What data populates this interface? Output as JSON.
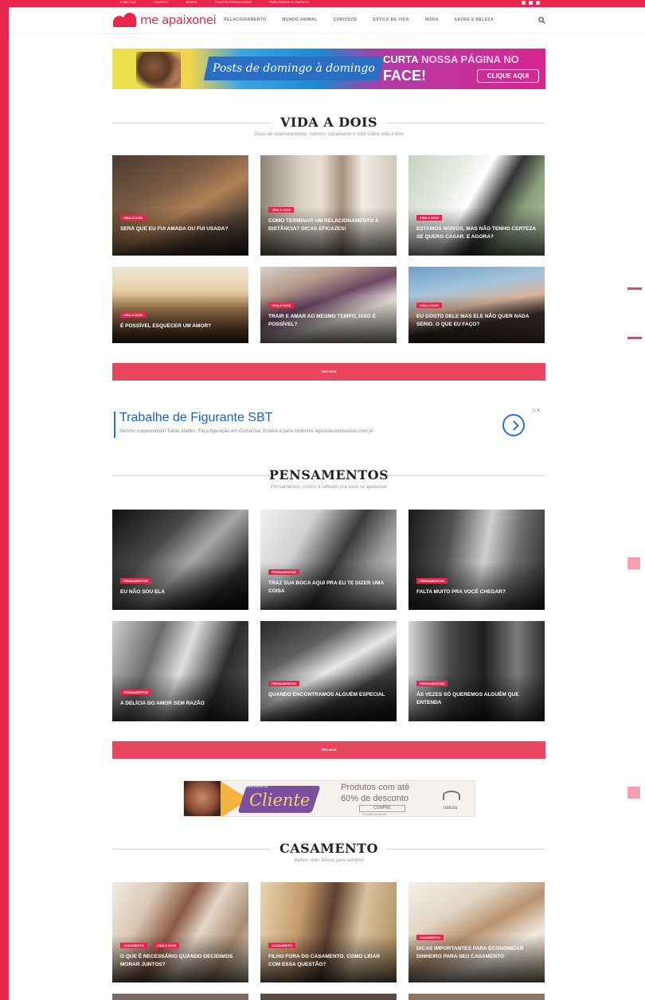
{
  "topbar": {
    "links": [
      "COMO FAZ",
      "CONTATO",
      "BRASIL",
      "POLÍTICA PRIVACIDADE",
      "PUBLICIDADE E CONTATO"
    ]
  },
  "header": {
    "logo_text": "me apaixonei",
    "nav": [
      "RELACIONAMENTO",
      "MUNDO ANIMAL",
      "CURIOSOS",
      "ESTILO DE VIDA",
      "MODA",
      "SAÚDE E BELEZA"
    ],
    "accent": "#e8254a"
  },
  "banner": {
    "script_text": "Posts de domingo à domingo",
    "cta_curta": "CURTA",
    "cta_nossa": "NOSSA PÁGINA NO",
    "cta_face": "FACE!",
    "button": "CLIQUE AQUI"
  },
  "sections": [
    {
      "title": "VIDA A DOIS",
      "subtitle": "Dicas de relacionamento, namoro, casamento e tudo sobre vida a dois",
      "see_more": "VER MAIS",
      "cards": [
        {
          "tag": "VIDA A DOIS",
          "title": "SERÁ QUE EU FUI AMADA OU FUI USADA?"
        },
        {
          "tag": "VIDA A DOIS",
          "title": "COMO TERMINAR UM RELACIONAMENTO À DISTÂNCIA? DICAS EFICAZES!"
        },
        {
          "tag": "VIDA A DOIS",
          "title": "ESTAMOS NOIVOS, MAS NÃO TENHO CERTEZA SE QUERO CASAR. E AGORA?"
        },
        {
          "tag": "VIDA A DOIS",
          "title": "É POSSÍVEL ESQUECER UM AMOR?"
        },
        {
          "tag": "VIDA A DOIS",
          "title": "TRAIR E AMAR AO MESMO TEMPO, ISSO É POSSÍVEL?"
        },
        {
          "tag": "VIDA A DOIS",
          "title": "EU GOSTO DELE MAS ELE NÃO QUER NADA SÉRIO. O QUE EU FAÇO?"
        }
      ]
    },
    {
      "title": "PENSAMENTOS",
      "subtitle": "Pensamentos, contos e reflexos pra você se apaixonar",
      "see_more": "VER MAIS",
      "cards": [
        {
          "tag": "PENSAMENTOS",
          "title": "EU NÃO SOU ELA"
        },
        {
          "tag": "PENSAMENTOS",
          "title": "TRAZ SUA BOCA AQUI PRA EU TE DIZER UMA COISA"
        },
        {
          "tag": "PENSAMENTOS",
          "title": "FALTA MUITO PRA VOCÊ CHEGAR?"
        },
        {
          "tag": "PENSAMENTOS",
          "title": "A DELÍCIA DO AMOR SEM RAZÃO"
        },
        {
          "tag": "PENSAMENTOS",
          "title": "QUANDO ENCONTRAMOS ALGUÉM ESPECIAL"
        },
        {
          "tag": "PENSAMENTOS",
          "title": "ÀS VEZES SÓ QUEREMOS ALGUÉM QUE ENTENDA"
        }
      ]
    },
    {
      "title": "CASAMENTO",
      "subtitle": "Vamos viver felizes para sempre!",
      "cards": [
        {
          "tag": "CASAMENTO",
          "tag2": "VIDA A DOIS",
          "title": "O QUE É NECESSÁRIO QUANDO DECIDIMOS MORAR JUNTOS?"
        },
        {
          "tag": "CASAMENTO",
          "title": "FILHO FORA DO CASAMENTO. COMO LIDAR COM ESSA QUESTÃO?"
        },
        {
          "tag": "CASAMENTO",
          "title": "DICAS IMPORTANTES PARA ECONOMIZAR DINHEIRO PARA SEU CASAMENTO"
        }
      ]
    }
  ],
  "ad_text": {
    "title": "Trabalhe de Figurante SBT",
    "desc": "Mesmo surpreendido! Todas Idades, Faça figuração em Comercial, Novela e para melhores agencias/emissoras com jo",
    "choice": "▷✕"
  },
  "ad_natura": {
    "pill_small": "Semana do",
    "pill_big": "Cliente",
    "line1": "Produtos com até",
    "line2": "60% de desconto",
    "button": "COMPRE",
    "foot": "Consulte condições",
    "logo": "natura"
  }
}
